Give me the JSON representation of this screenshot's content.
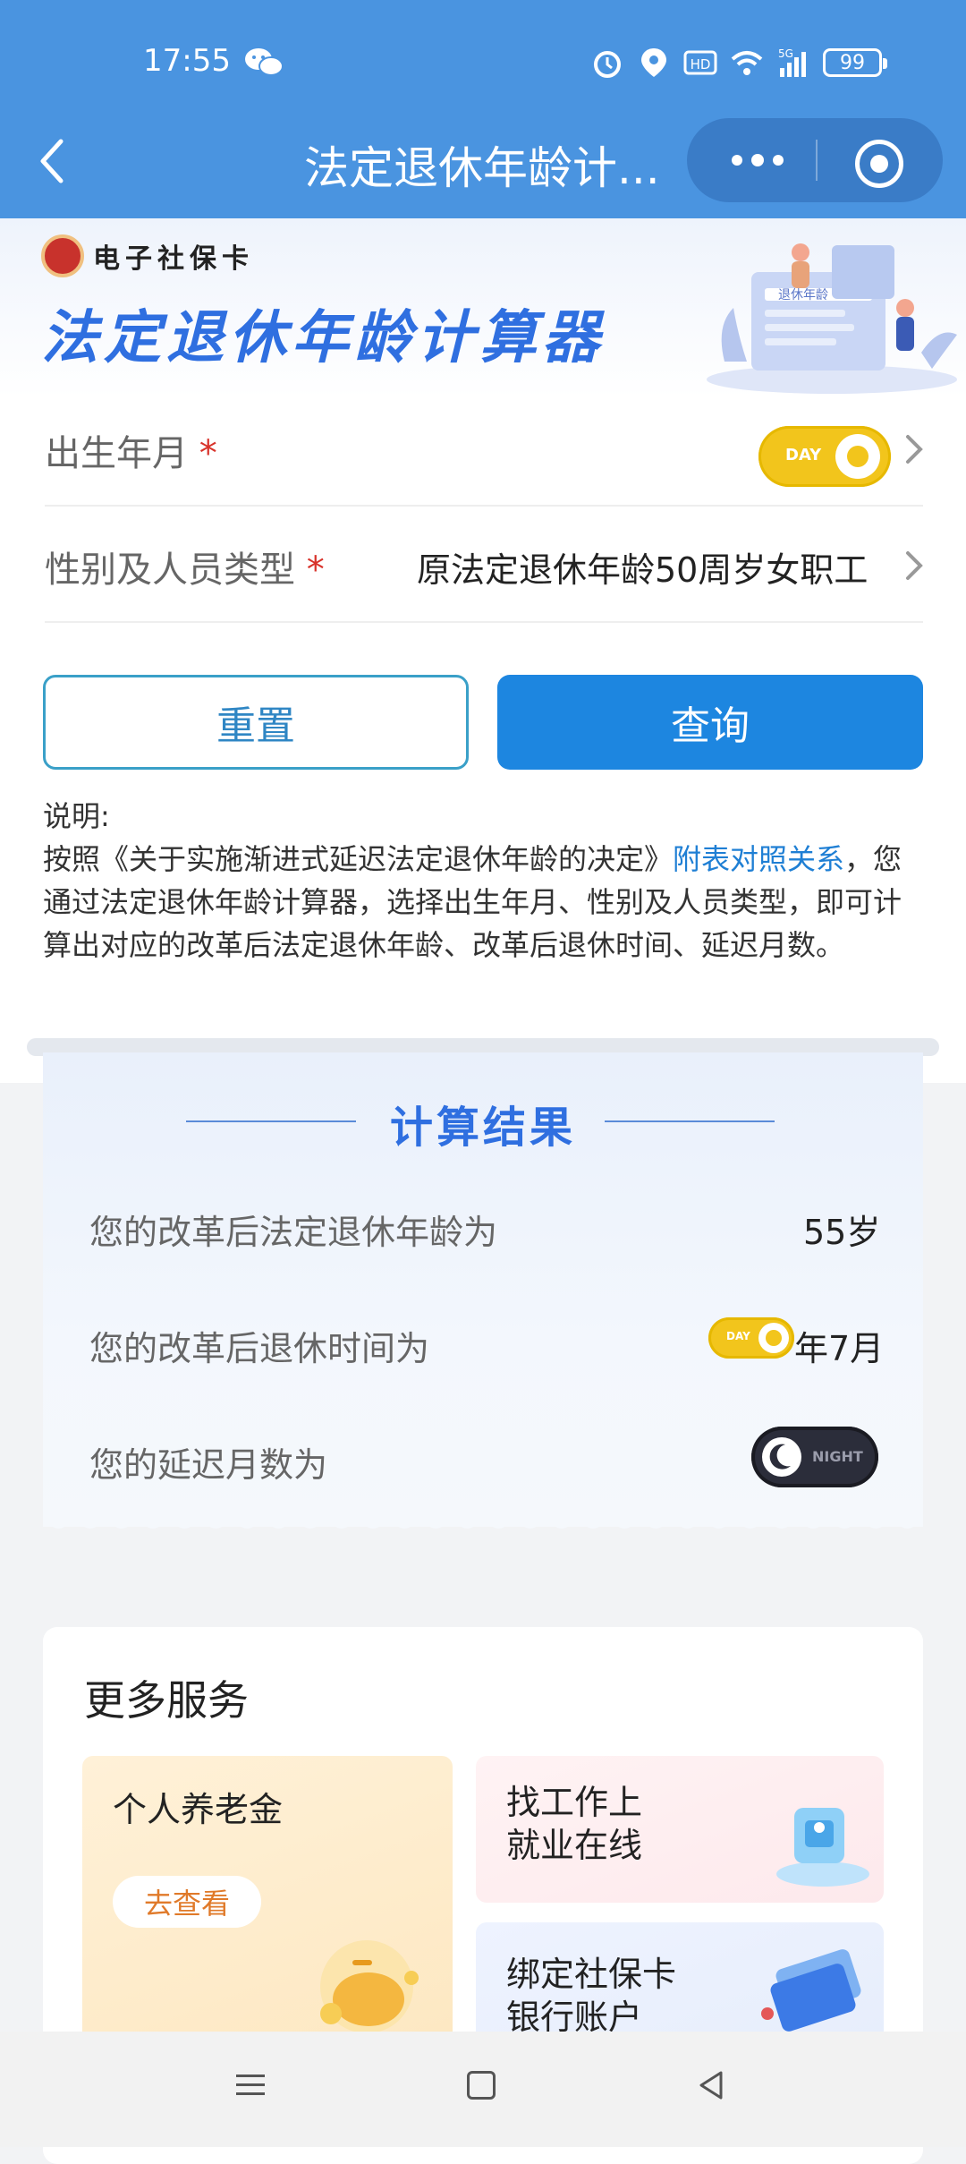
{
  "status_bar": {
    "time": "17:55",
    "network": "5G",
    "battery": "99"
  },
  "nav": {
    "title": "法定退休年龄计..."
  },
  "banner": {
    "logo_text": "电子社保卡",
    "title": "法定退休年龄计算器",
    "illustration_text": "退休年龄"
  },
  "form": {
    "birth_label": "出生年月",
    "type_label": "性别及人员类型",
    "required_mark": "*",
    "type_value": "原法定退休年龄50周岁女职工",
    "toggle_day_label": "DAY"
  },
  "buttons": {
    "reset": "重置",
    "query": "查询"
  },
  "description": {
    "heading": "说明:",
    "text_before_link": "按照《关于实施渐进式延迟法定退休年龄的决定》",
    "link": "附表对照关系",
    "text_after_link": "，您通过法定退休年龄计算器，选择出生年月、性别及人员类型，即可计算出对应的改革后法定退休年龄、改革后退休时间、延迟月数。"
  },
  "result": {
    "title": "计算结果",
    "rows": [
      {
        "label": "您的改革后法定退休年龄为",
        "value": "55岁"
      },
      {
        "label": "您的改革后退休时间为",
        "value": "年7月",
        "toggle_label": "DAY"
      },
      {
        "label": "您的延迟月数为",
        "toggle_label": "NIGHT"
      }
    ]
  },
  "services": {
    "title": "更多服务",
    "tiles": [
      {
        "label": "个人养老金",
        "button": "去查看"
      },
      {
        "line1": "找工作上",
        "line2": "就业在线"
      },
      {
        "line1": "绑定社保卡",
        "line2": "银行账户"
      }
    ]
  },
  "colors": {
    "primary": "#1d86e0",
    "header": "#4a94e0",
    "accent_title": "#2f6fe0",
    "required": "#d8332b",
    "toggle_day": "#f2c51c"
  }
}
